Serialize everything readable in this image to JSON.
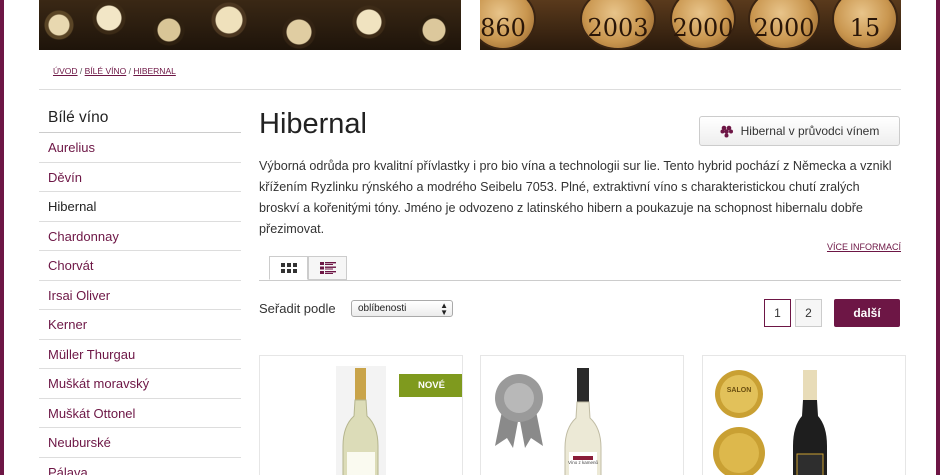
{
  "breadcrumb": {
    "home": "ÚVOD",
    "sep1": " / ",
    "category": "BÍLÉ VÍNO",
    "sep2": " / ",
    "current": "HIBERNAL"
  },
  "banner": {
    "cork_years": [
      "860",
      "2003",
      "2000",
      "2000",
      "15"
    ]
  },
  "sidebar": {
    "title": "Bílé víno",
    "items": [
      {
        "label": "Aurelius"
      },
      {
        "label": "Děvín"
      },
      {
        "label": "Hibernal",
        "active": true
      },
      {
        "label": "Chardonnay"
      },
      {
        "label": "Chorvát"
      },
      {
        "label": "Irsai Oliver"
      },
      {
        "label": "Kerner"
      },
      {
        "label": "Müller Thurgau"
      },
      {
        "label": "Muškát moravský"
      },
      {
        "label": "Muškát Ottonel"
      },
      {
        "label": "Neuburské"
      },
      {
        "label": "Pálava"
      }
    ]
  },
  "main": {
    "title": "Hibernal",
    "guide_button": "Hibernal v průvodci vínem",
    "description": "Výborná odrůda pro kvalitní přívlastky i pro bio vína a technologii sur lie. Tento hybrid pochází z Německa a vznikl křížením Ryzlinku rýnského a modrého Seibelu 7053. Plné, extraktivní víno s charakteristickou chutí zralých broskví a kořenitými tóny. Jméno je odvozeno z latinského hibern a poukazuje na schopnost hibernalu dobře přezimovat.",
    "more_link": "VÍCE INFORMACÍ",
    "sort_label": "Seřadit podle",
    "sort_value": "oblíbenosti",
    "pages": [
      "1",
      "2"
    ],
    "current_page": "1",
    "next_label": "další"
  },
  "products": [
    {
      "badge": "NOVÉ"
    },
    {
      "award_label": "Víno z kamenů"
    },
    {
      "medal_text": "SALON"
    }
  ],
  "colors": {
    "brand": "#6d1645",
    "new_badge": "#7f9a1e"
  }
}
